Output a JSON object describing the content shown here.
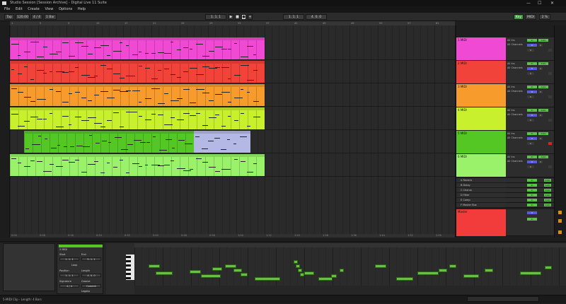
{
  "window": {
    "title": "Studio Session [Session Archive] - Digital Live 11 Suite",
    "min": "—",
    "max": "☐",
    "close": "✕"
  },
  "menu": [
    "File",
    "Edit",
    "Create",
    "View",
    "Options",
    "Help"
  ],
  "transport": {
    "tap": "Tap",
    "tempo": "120.00",
    "signature": "4 / 4",
    "quantize": "1 Bar",
    "position": "1. 1. 1",
    "loop_start": "1. 1. 1",
    "loop_length": "4. 0. 0",
    "key": "Key",
    "midi": "MIDI",
    "cpu": "2 %"
  },
  "ruler": [
    "1",
    "5",
    "9",
    "13",
    "17",
    "21",
    "25",
    "29",
    "33",
    "37",
    "41",
    "45",
    "49",
    "53",
    "57",
    "61"
  ],
  "bottom_ruler": [
    "0:00",
    "0:08",
    "0:16",
    "0:24",
    "0:32",
    "0:40",
    "0:48",
    "0:56",
    "1:04",
    "1:12",
    "1:20",
    "1:28",
    "1:36",
    "1:44",
    "1:52",
    "2:00"
  ],
  "tracks": [
    {
      "name": "1 MIDI",
      "color": "#f04ad4"
    },
    {
      "name": "2 MIDI",
      "color": "#f2433a"
    },
    {
      "name": "3 MIDI",
      "color": "#f79b2c"
    },
    {
      "name": "4 MIDI",
      "color": "#c8f02c"
    },
    {
      "name": "5 MIDI",
      "color": "#55c724"
    },
    {
      "name": "6 MIDI",
      "color": "#9af26a"
    }
  ],
  "returns": [
    "A Reverb",
    "B Delay",
    "C Chorus",
    "D Filter",
    "E Comp",
    "F Master Bus"
  ],
  "master": {
    "name": "Master",
    "color": "#f23b3b"
  },
  "mixer": {
    "in": "All Ins",
    "ch": "All Channels",
    "monitor_in": "In",
    "monitor_auto": "Auto",
    "monitor_off": "Off",
    "volume": "0",
    "pan": "C",
    "solo": "S"
  },
  "clip_view": {
    "title": "5 MIDI",
    "start": "Start",
    "end": "End",
    "start_val": "1. 1. 1",
    "end_val": "5. 1. 1",
    "loop": "Loop",
    "position": "Position",
    "length": "Length",
    "signature": "Signature",
    "groove": "Groove",
    "legato": "Legato",
    "commit": "Commit"
  },
  "status": "5-MIDI Clip - Length: 4 Bars",
  "colors": {
    "accent": "#64c23c",
    "selected_clip": "#b4b8e4"
  }
}
